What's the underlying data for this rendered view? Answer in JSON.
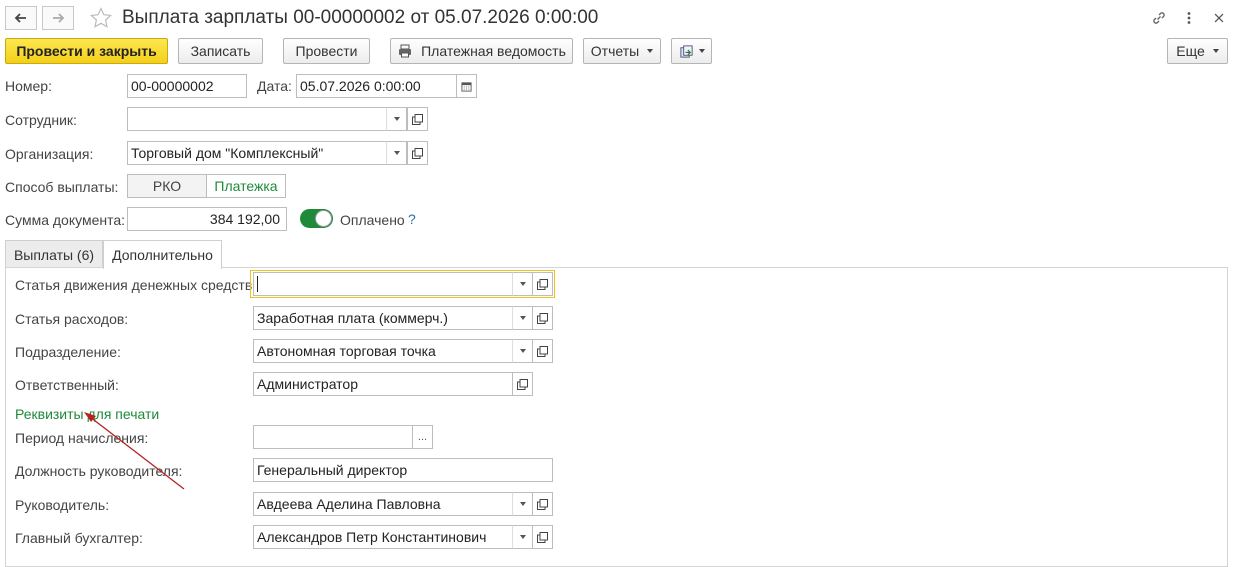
{
  "title": "Выплата зарплаты 00-00000002 от 05.07.2026 0:00:00",
  "toolbar": {
    "post_close": "Провести и закрыть",
    "save": "Записать",
    "post": "Провести",
    "payroll": "Платежная ведомость",
    "reports": "Отчеты",
    "more": "Еще"
  },
  "header": {
    "number_label": "Номер:",
    "number_value": "00-00000002",
    "date_label": "Дата:",
    "date_value": "05.07.2026  0:00:00",
    "employee_label": "Сотрудник:",
    "employee_value": "",
    "org_label": "Организация:",
    "org_value": "Торговый дом \"Комплексный\"",
    "payment_method_label": "Способ выплаты:",
    "payment_options": [
      "РКО",
      "Платежка"
    ],
    "payment_selected": "Платежка",
    "sum_label": "Сумма документа:",
    "sum_value": "384 192,00",
    "paid_label": "Оплачено",
    "paid": true,
    "help": "?"
  },
  "tabs": [
    {
      "label": "Выплаты (6)",
      "active": false
    },
    {
      "label": "Дополнительно",
      "active": true
    }
  ],
  "additional": {
    "cashflow_label": "Статья движения денежных средств:",
    "cashflow_value": "",
    "expense_label": "Статья расходов:",
    "expense_value": "Заработная плата (коммерч.)",
    "dept_label": "Подразделение:",
    "dept_value": "Автономная торговая точка",
    "responsible_label": "Ответственный:",
    "responsible_value": "Администратор",
    "print_details_link": "Реквизиты для печати",
    "period_label": "Период начисления:",
    "period_value": "",
    "period_btn": "...",
    "head_position_label": "Должность руководителя:",
    "head_position_value": "Генеральный директор",
    "head_label": "Руководитель:",
    "head_value": "Авдеева Аделина Павловна",
    "accountant_label": "Главный бухгалтер:",
    "accountant_value": "Александров Петр Константинович"
  },
  "colors": {
    "primary_button": "#f4cf1a",
    "accent_green": "#1f8a3a",
    "focus_border": "#f0c419",
    "annotation_arrow": "#b42323"
  }
}
